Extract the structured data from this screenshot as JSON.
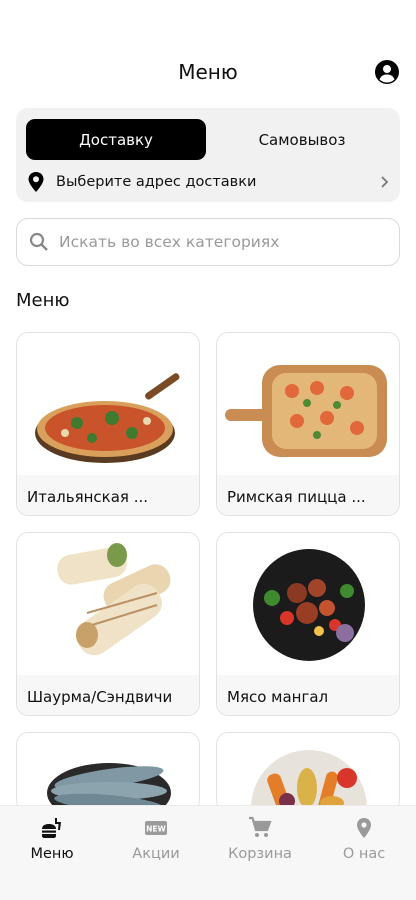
{
  "header": {
    "title": "Меню",
    "profile_icon": "account-circle-icon"
  },
  "delivery": {
    "active_mode": "Доставку",
    "other_mode": "Самовывоз",
    "address_prompt": "Выберите адрес доставки",
    "pin_icon": "location-pin-icon",
    "chevron_icon": "chevron-right-icon"
  },
  "search": {
    "placeholder": "Искать во всех категориях",
    "icon": "search-icon"
  },
  "section_title": "Меню",
  "categories": [
    {
      "label": "Итальянская ...",
      "image": "pizza-on-board"
    },
    {
      "label": "Римская пицца ...",
      "image": "roman-pizza-on-board"
    },
    {
      "label": "Шаурма/Сэндвичи",
      "image": "shawarma-wraps"
    },
    {
      "label": "Мясо мангал",
      "image": "grilled-meat-plate"
    },
    {
      "label": "",
      "image": "fish-plate"
    },
    {
      "label": "",
      "image": "roasted-vegetables"
    }
  ],
  "bottom_nav": [
    {
      "label": "Меню",
      "icon": "fastfood-icon",
      "active": true
    },
    {
      "label": "Акции",
      "icon": "new-badge-icon",
      "active": false
    },
    {
      "label": "Корзина",
      "icon": "cart-icon",
      "active": false
    },
    {
      "label": "О нас",
      "icon": "location-pin-icon",
      "active": false
    }
  ],
  "colors": {
    "accent": "#000000",
    "inactive": "#9a9a9a",
    "card_bg": "#f1f1f1"
  }
}
